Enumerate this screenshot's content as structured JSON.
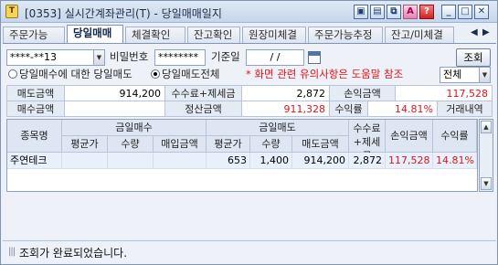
{
  "window": {
    "title": "[0353] 실시간계좌관리(T) - 당일매매일지",
    "app_icon_glyph": "T",
    "controls": [
      "restore",
      "save",
      "link",
      "print",
      "help",
      "minimize",
      "maximize",
      "close"
    ]
  },
  "tabs": [
    {
      "label": "주문가능",
      "active": false
    },
    {
      "label": "당일매매",
      "active": true
    },
    {
      "label": "체결확인",
      "active": false
    },
    {
      "label": "잔고확인",
      "active": false
    },
    {
      "label": "원장미체결",
      "active": false
    },
    {
      "label": "주문가능추정",
      "active": false
    },
    {
      "label": "잔고/미체결",
      "active": false
    }
  ],
  "query": {
    "account_value": "****-**13",
    "password_label": "비밀번호",
    "password_value": "********",
    "date_label": "기준일",
    "date_value": "/ /",
    "search_button": "조회"
  },
  "options": {
    "radio1_label": "당일매수에 대한 당일매도",
    "radio2_label": "당일매도전체",
    "selected": "radio2",
    "notice": "* 화면 관련 유의사항은 도움말 참조",
    "filter_value": "전체"
  },
  "summary": {
    "row1": [
      {
        "label": "매도금액",
        "value": "914,200"
      },
      {
        "label": "수수료+제세금",
        "value": "2,872"
      },
      {
        "label": "손익금액",
        "value": "117,528"
      }
    ],
    "row2": [
      {
        "label": "매수금액",
        "value": ""
      },
      {
        "label": "정산금액",
        "value": "911,328"
      },
      {
        "label": "수익률",
        "value": "14.81%"
      },
      {
        "label": "거래내역",
        "value": ""
      }
    ]
  },
  "table": {
    "header": {
      "stock_name": "종목명",
      "buy_group": "금일매수",
      "sell_group": "금일매도",
      "fee": "수수료\n+제세금",
      "pl_amount": "손익금액",
      "return_rate": "수익률",
      "buy_cols": [
        "평균가",
        "수량",
        "매입금액"
      ],
      "sell_cols": [
        "평균가",
        "수량",
        "매도금액"
      ]
    },
    "rows": [
      {
        "name": "주연테크",
        "buy_avg": "",
        "buy_qty": "",
        "buy_amount": "",
        "sell_avg": "653",
        "sell_qty": "1,400",
        "sell_amount": "914,200",
        "fee": "2,872",
        "pl": "117,528",
        "rate": "14.81%"
      }
    ]
  },
  "status": {
    "message": "조회가 완료되었습니다."
  },
  "colors": {
    "accent_red": "#e2141a",
    "header_bg": "#dde6f2",
    "row_bg": "#e8f0fb"
  }
}
